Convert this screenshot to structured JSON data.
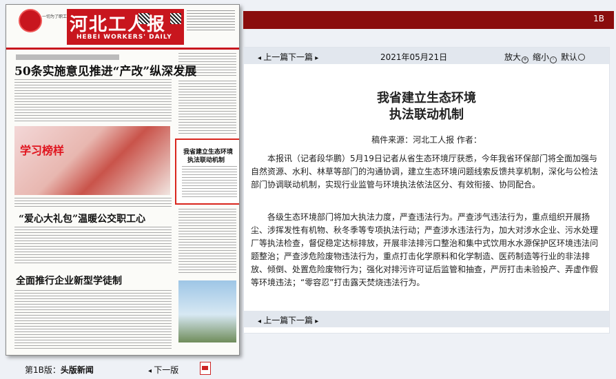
{
  "top": {
    "page_code": "1B"
  },
  "newspaper": {
    "title": "河北工人报",
    "subtitle": "HEBEI WORKERS' DAILY",
    "motto": "一切为了职工群众",
    "headline1": "50条实施意见推进“产改”纵深发展",
    "headline2": "学习榜样",
    "headline3": "“爱心大礼包”温暖公交职工心",
    "headline4": "全面推行企业新型学徒制",
    "box_title1": "我省建立生态环境",
    "box_title2": "执法联动机制"
  },
  "footer": {
    "edition_prefix": "第1B版：",
    "edition_name": "头版新闻",
    "next_edition": "下一版"
  },
  "nav": {
    "prev": "上一篇",
    "next": "下一篇"
  },
  "article": {
    "date": "2021年05月21日",
    "zoom_in": "放大",
    "zoom_out": "缩小",
    "zoom_default": "默认",
    "title_line1": "我省建立生态环境",
    "title_line2": "执法联动机制",
    "source": "稿件来源：河北工人报  作者：",
    "paragraph1": "本报讯（记者段华鹏）5月19日记者从省生态环境厅获悉，今年我省环保部门将全面加强与自然资源、水利、林草等部门的沟通协调，建立生态环境问题线索反馈共享机制，深化与公检法部门协调联动机制，实现行业监管与环境执法依法区分、有效衔接、协同配合。",
    "paragraph2": "各级生态环境部门将加大执法力度，严查违法行为。严查涉气违法行为，重点组织开展扬尘、涉挥发性有机物、秋冬季等专项执法行动；严查涉水违法行为，加大对涉水企业、污水处理厂等执法检查，督促稳定达标排放，开展非法排污口整治和集中式饮用水水源保护区环境违法问题整治；严查涉危险废物违法行为，重点打击化学原料和化学制造、医药制造等行业的非法排放、倾倒、处置危险废物行为；强化对排污许可证后监管和抽查，严厉打击未验投产、弄虚作假等环境违法；“零容忍”打击露天焚烧违法行为。"
  },
  "colors": {
    "brand_red": "#c8161e",
    "top_bar": "#8a0d0d"
  }
}
